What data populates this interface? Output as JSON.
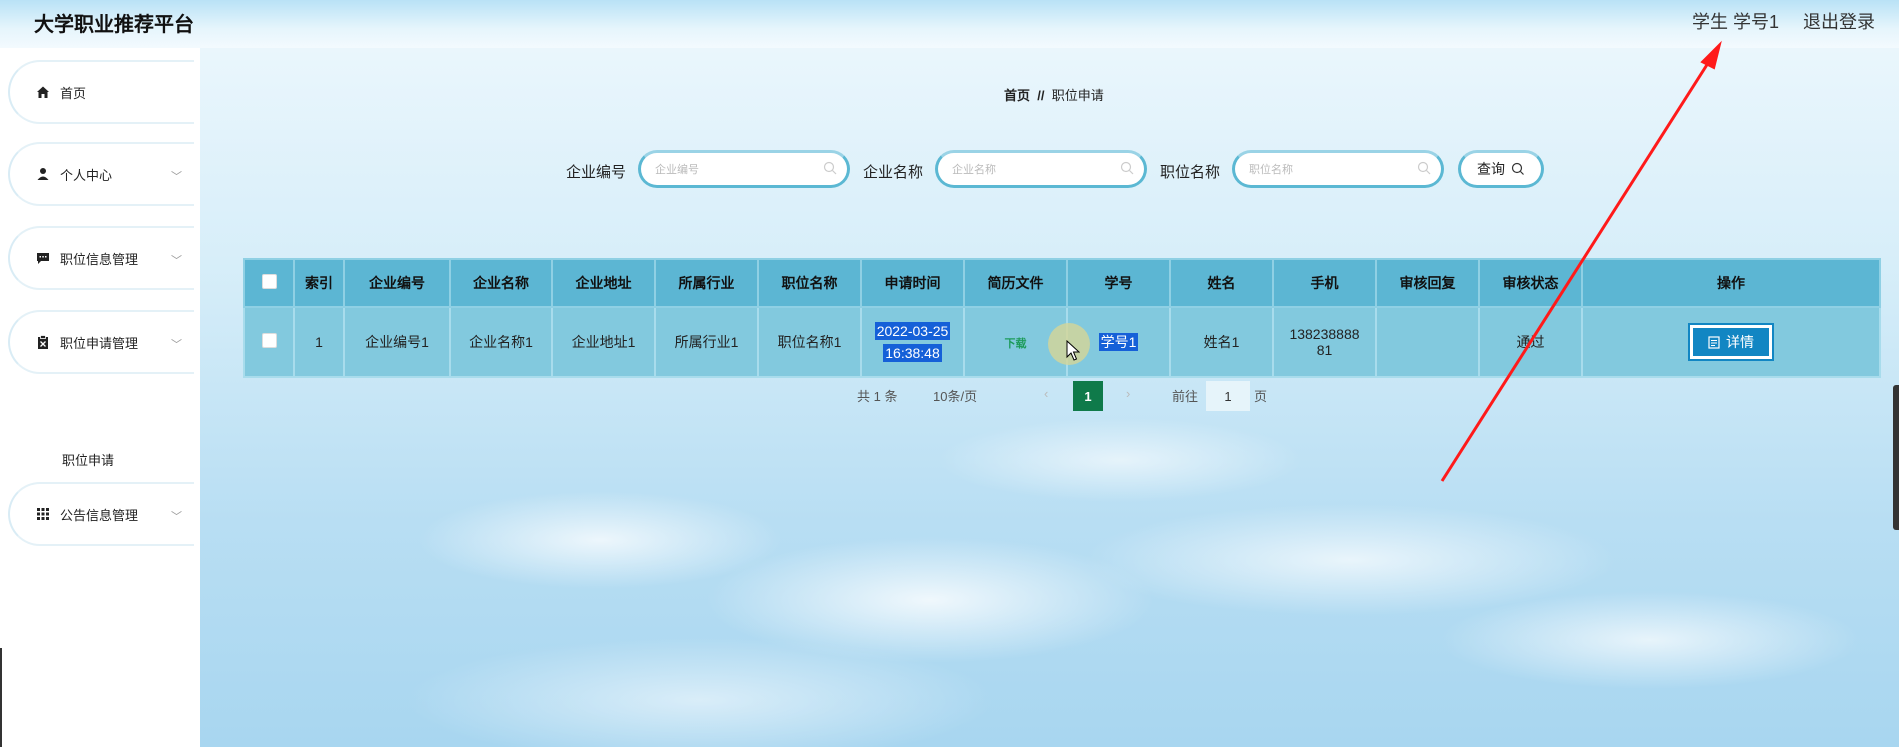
{
  "app": {
    "title": "大学职业推荐平台"
  },
  "header": {
    "user": "学生 学号1",
    "logout": "退出登录"
  },
  "sidebar": {
    "items": [
      {
        "label": "首页",
        "icon": "home-icon"
      },
      {
        "label": "个人中心",
        "icon": "user-icon"
      },
      {
        "label": "职位信息管理",
        "icon": "message-icon"
      },
      {
        "label": "职位申请管理",
        "icon": "clipboard-icon"
      },
      {
        "label": "公告信息管理",
        "icon": "grid-icon"
      }
    ],
    "sub_item": "职位申请"
  },
  "breadcrumb": {
    "home": "首页",
    "sep": "//",
    "current": "职位申请"
  },
  "search": {
    "fields": [
      {
        "label": "企业编号",
        "placeholder": "企业编号"
      },
      {
        "label": "企业名称",
        "placeholder": "企业名称"
      },
      {
        "label": "职位名称",
        "placeholder": "职位名称"
      }
    ],
    "button": "查询"
  },
  "table": {
    "headers": [
      "",
      "索引",
      "企业编号",
      "企业名称",
      "企业地址",
      "所属行业",
      "职位名称",
      "申请时间",
      "简历文件",
      "学号",
      "姓名",
      "手机",
      "审核回复",
      "审核状态",
      "操作"
    ],
    "rows": [
      {
        "index": "1",
        "company_no": "企业编号1",
        "company_name": "企业名称1",
        "company_addr": "企业地址1",
        "industry": "所属行业1",
        "position": "职位名称1",
        "apply_date": "2022-03-25",
        "apply_time": "16:38:48",
        "resume": "下载",
        "student_no": "学号1",
        "name": "姓名1",
        "phone_a": "138238888",
        "phone_b": "81",
        "reply": "",
        "status": "通过",
        "action": "详情"
      }
    ]
  },
  "pagination": {
    "total": "共 1 条",
    "page_size": "10条/页",
    "prev": "‹",
    "current": "1",
    "next": "›",
    "goto_label": "前往",
    "goto_value": "1",
    "goto_suffix": "页"
  },
  "colors": {
    "header": "#5cb6d3",
    "row": "#82c9de",
    "accent": "#1286c3",
    "annotation": "#ff1a1a"
  }
}
